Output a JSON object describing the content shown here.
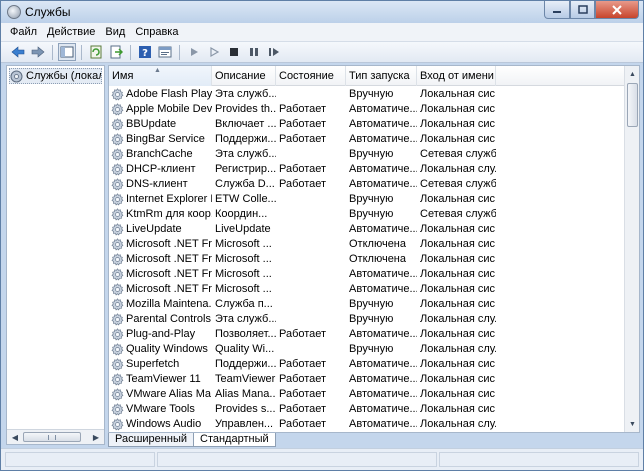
{
  "window": {
    "title": "Службы"
  },
  "menu": [
    "Файл",
    "Действие",
    "Вид",
    "Справка"
  ],
  "toolbar": [
    "back-arrow-icon",
    "forward-arrow-icon",
    "console-tree-icon",
    "refresh-icon",
    "export-icon",
    "help-icon",
    "properties-icon",
    "play-icon",
    "play-outline-icon",
    "stop-icon",
    "pause-icon",
    "restart-icon"
  ],
  "tree": {
    "item": "Службы (локаль"
  },
  "table": {
    "columns": [
      "Имя",
      "Описание",
      "Состояние",
      "Тип запуска",
      "Вход от имени"
    ],
    "rows": [
      [
        "Adobe Flash Playe...",
        "Эта служб...",
        "",
        "Вручную",
        "Локальная сис..."
      ],
      [
        "Apple Mobile Devi...",
        "Provides th...",
        "Работает",
        "Автоматиче...",
        "Локальная сис..."
      ],
      [
        "BBUpdate",
        "Включает ...",
        "Работает",
        "Автоматиче...",
        "Локальная сис..."
      ],
      [
        "BingBar Service",
        "Поддержи...",
        "Работает",
        "Автоматиче...",
        "Локальная сис..."
      ],
      [
        "BranchCache",
        "Эта служб...",
        "",
        "Вручную",
        "Сетевая служба"
      ],
      [
        "DHCP-клиент",
        "Регистрир...",
        "Работает",
        "Автоматиче...",
        "Локальная слу..."
      ],
      [
        "DNS-клиент",
        "Служба D...",
        "Работает",
        "Автоматиче...",
        "Сетевая служба"
      ],
      [
        "Internet Explorer E...",
        "ETW Colle...",
        "",
        "Вручную",
        "Локальная сис..."
      ],
      [
        "KtmRm для коор...",
        "Координ...",
        "",
        "Вручную",
        "Сетевая служба"
      ],
      [
        "LiveUpdate",
        "LiveUpdate",
        "",
        "Автоматиче...",
        "Локальная сис..."
      ],
      [
        "Microsoft .NET Fr...",
        "Microsoft ...",
        "",
        "Отключена",
        "Локальная сис..."
      ],
      [
        "Microsoft .NET Fr...",
        "Microsoft ...",
        "",
        "Отключена",
        "Локальная сис..."
      ],
      [
        "Microsoft .NET Fr...",
        "Microsoft ...",
        "",
        "Автоматиче...",
        "Локальная сис..."
      ],
      [
        "Microsoft .NET Fr...",
        "Microsoft ...",
        "",
        "Автоматиче...",
        "Локальная сис..."
      ],
      [
        "Mozilla Maintena...",
        "Служба п...",
        "",
        "Вручную",
        "Локальная сис..."
      ],
      [
        "Parental Controls",
        "Эта служб...",
        "",
        "Вручную",
        "Локальная слу..."
      ],
      [
        "Plug-and-Play",
        "Позволяет...",
        "Работает",
        "Автоматиче...",
        "Локальная сис..."
      ],
      [
        "Quality Windows ...",
        "Quality Wi...",
        "",
        "Вручную",
        "Локальная слу..."
      ],
      [
        "Superfetch",
        "Поддержи...",
        "Работает",
        "Автоматиче...",
        "Локальная сис..."
      ],
      [
        "TeamViewer 11",
        "TeamViewer ...",
        "Работает",
        "Автоматиче...",
        "Локальная сис..."
      ],
      [
        "VMware Alias Ma...",
        "Alias Mana...",
        "Работает",
        "Автоматиче...",
        "Локальная сис..."
      ],
      [
        "VMware Tools",
        "Provides s...",
        "Работает",
        "Автоматиче...",
        "Локальная сис..."
      ],
      [
        "Windows Audio",
        "Управлен...",
        "Работает",
        "Автоматиче...",
        "Локальная слу..."
      ]
    ]
  },
  "tabs": [
    "Расширенный",
    "Стандартный"
  ]
}
